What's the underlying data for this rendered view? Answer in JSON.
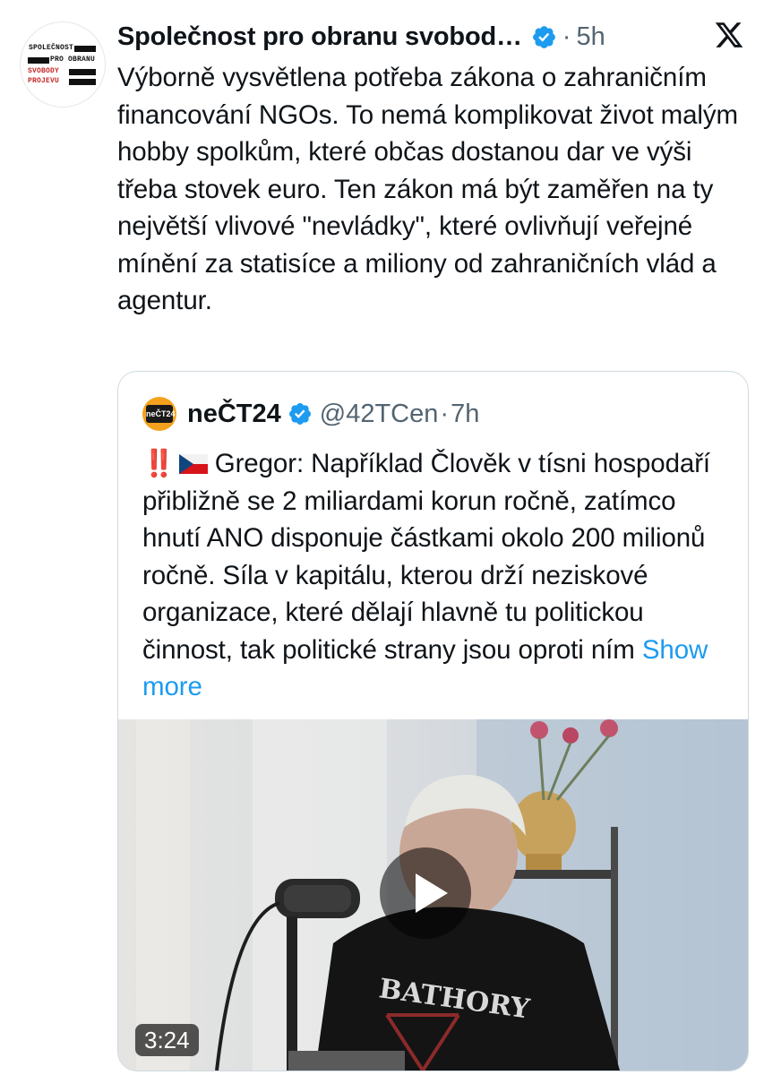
{
  "tweet": {
    "author_name": "Společnost pro obranu svobod…",
    "time": "5h",
    "separator": "·",
    "avatar_text": [
      "SPOLEČNOST",
      "PRO OBRANU",
      "SVOBODY",
      "PROJEVU"
    ],
    "text": "Výborně vysvětlena potřeba zákona o zahraničním financování NGOs. To nemá komplikovat život malým hobby spolkům, které občas dostanou dar ve výši třeba stovek euro. Ten zákon má být zaměřen na ty největší vlivové \"nevládky\", které ovlivňují veřejné mínění za statisíce a miliony od zahraničních vlád a agentur."
  },
  "quoted": {
    "author_name": "neČT24",
    "handle": "@42TCen",
    "separator": "·",
    "time": "7h",
    "avatar_text": "neČT24",
    "emoji_bang": "‼️",
    "text": "Gregor: Například Člověk v tísni hospodaří přibližně se 2 miliardami korun ročně, zatímco hnutí ANO disponuje částkami okolo 200 milionů ročně. Síla v kapitálu, kterou drží neziskové organizace, které dělají hlavně tu politickou činnost, tak politické strany jsou oproti ním",
    "show_more": "Show more",
    "video": {
      "duration": "3:24",
      "shirt_text": "BATHORY"
    }
  },
  "colors": {
    "verified": "#1d9bf0",
    "link": "#1d9bf0",
    "meta": "#536471",
    "border": "#cfd9de"
  },
  "icons": [
    "verified-badge-icon",
    "x-logo-icon",
    "czech-flag-icon",
    "play-icon"
  ]
}
